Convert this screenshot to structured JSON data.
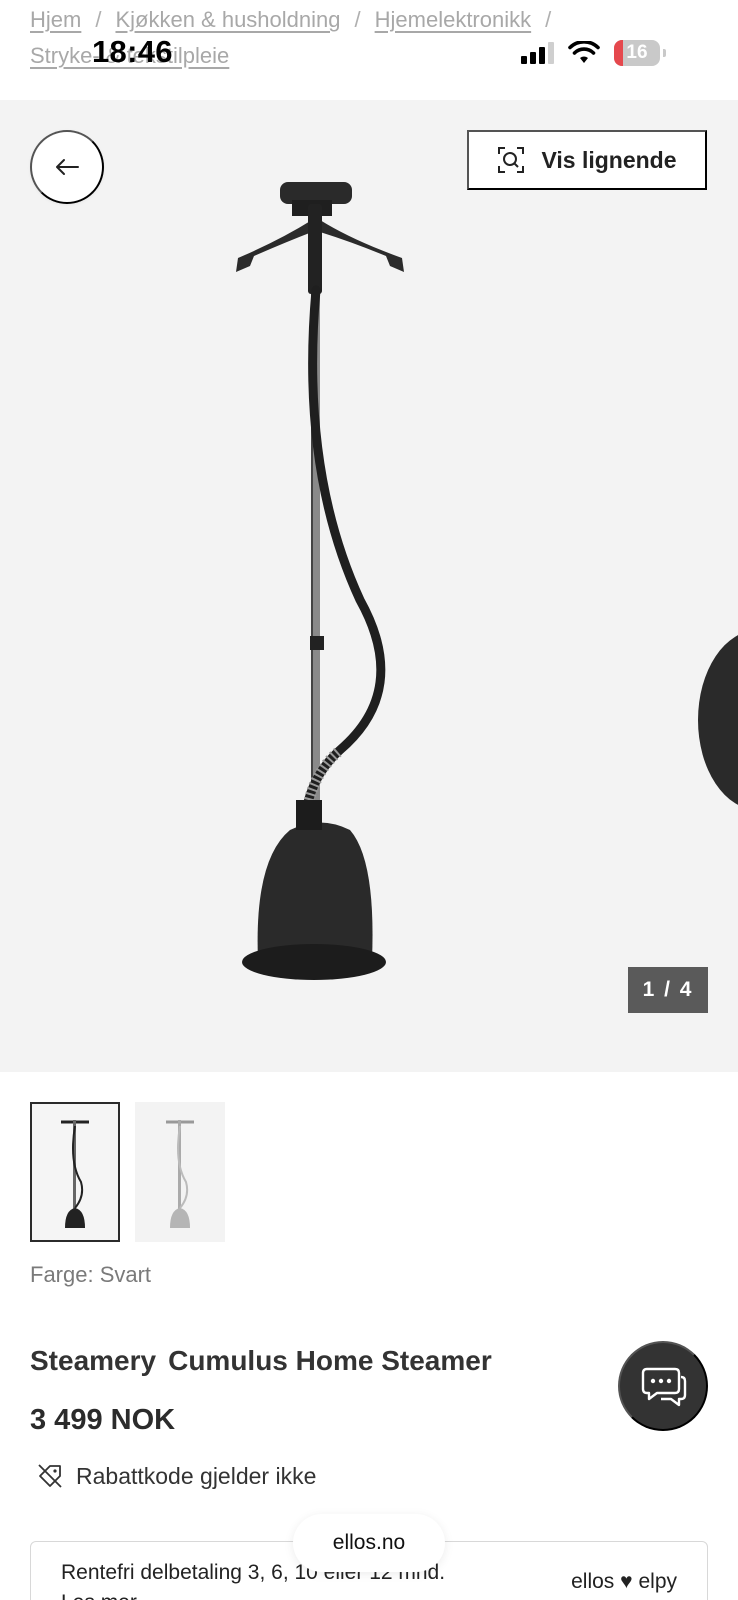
{
  "status_bar": {
    "time": "18:46",
    "battery": "16"
  },
  "breadcrumb": {
    "items": [
      "Hjem",
      "Kjøkken & husholdning",
      "Hjemelektronikk",
      "Stryke- & tekstilpleie"
    ],
    "separator": "/"
  },
  "gallery": {
    "similar_label": "Vis lignende",
    "counter": "1 / 4"
  },
  "product": {
    "color_label": "Farge: Svart",
    "brand": "Steamery",
    "name": "Cumulus Home Steamer",
    "price": "3 499 NOK",
    "discount_note": "Rabattkode gjelder ikke"
  },
  "finance": {
    "text": "Rentefri delbetaling 3, 6, 10 eller 12 mnd.",
    "more": "Les mer",
    "logo_left": "ellos",
    "logo_right": "elpy"
  },
  "browser": {
    "url": "ellos.no"
  },
  "colors": {
    "gallery_bg": "#f3f3f3",
    "counter_bg": "#5a5a5a",
    "chat_bg": "#333333"
  }
}
